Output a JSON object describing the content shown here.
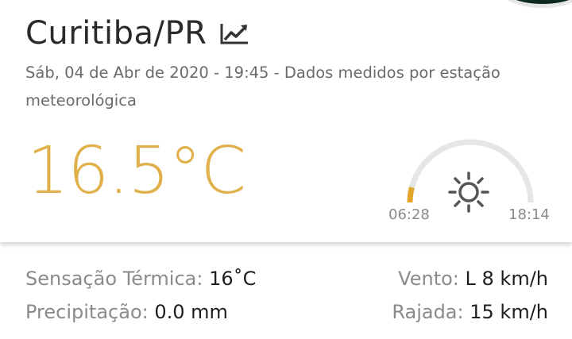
{
  "location": {
    "city": "Curitiba/PR"
  },
  "subtitle": "Sáb, 04 de Abr de 2020 - 19:45 - Dados medidos por estação meteorológica",
  "temperature": "16.5°C",
  "sun": {
    "sunrise": "06:28",
    "sunset": "18:14",
    "day_progress": 0.08
  },
  "stats": {
    "feels_like": {
      "label": "Sensação Térmica:",
      "value": "16˚C"
    },
    "precipitation": {
      "label": "Precipitação:",
      "value": "0.0 mm"
    },
    "wind": {
      "label": "Vento:",
      "value": "L 8 km/h"
    },
    "gust": {
      "label": "Rajada:",
      "value": "15 km/h"
    }
  },
  "icons": {
    "trend": "trending-up-icon",
    "sun": "sun-icon"
  },
  "colors": {
    "accent": "#e0b04a",
    "arc_track": "#e6e6e6",
    "text": "#2a2a2a",
    "muted": "#8a8a8a"
  }
}
